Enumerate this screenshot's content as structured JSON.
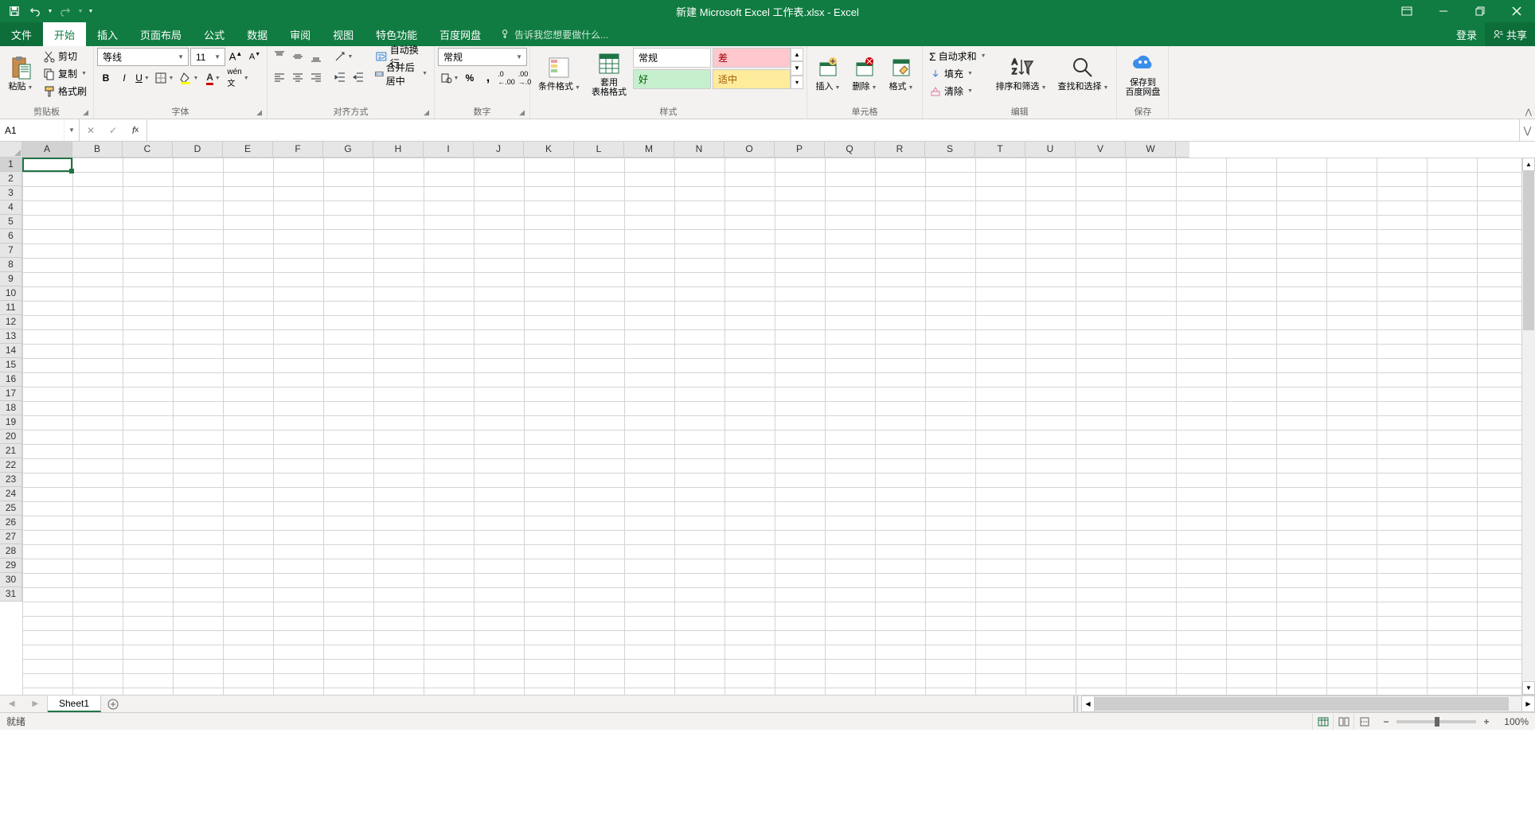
{
  "title": "新建 Microsoft Excel 工作表.xlsx - Excel",
  "qat": {
    "save": "保存",
    "undo": "撤销",
    "redo": "重做"
  },
  "tabs": {
    "file": "文件",
    "home": "开始",
    "insert": "插入",
    "pagelayout": "页面布局",
    "formulas": "公式",
    "data": "数据",
    "review": "审阅",
    "view": "视图",
    "features": "特色功能",
    "baidu": "百度网盘",
    "tellme": "告诉我您想要做什么...",
    "signin": "登录",
    "share": "共享"
  },
  "ribbon": {
    "clipboard": {
      "paste": "粘贴",
      "cut": "剪切",
      "copy": "复制",
      "format_painter": "格式刷",
      "label": "剪贴板"
    },
    "font": {
      "name": "等线",
      "size": "11",
      "label": "字体"
    },
    "alignment": {
      "wrap": "自动换行",
      "merge": "合并后居中",
      "label": "对齐方式"
    },
    "number": {
      "format": "常规",
      "label": "数字"
    },
    "styles": {
      "cond_fmt": "条件格式",
      "table_fmt": "套用\n表格格式",
      "g1": "常规",
      "g2": "差",
      "g3": "好",
      "g4": "适中",
      "label": "样式"
    },
    "cells": {
      "insert": "插入",
      "delete": "删除",
      "format": "格式",
      "label": "单元格"
    },
    "editing": {
      "autosum": "自动求和",
      "fill": "填充",
      "clear": "清除",
      "sort": "排序和筛选",
      "find": "查找和选择",
      "label": "编辑"
    },
    "baidu": {
      "save": "保存到\n百度网盘",
      "label": "保存"
    }
  },
  "formula_bar": {
    "name_box": "A1",
    "formula": ""
  },
  "columns": [
    "A",
    "B",
    "C",
    "D",
    "E",
    "F",
    "G",
    "H",
    "I",
    "J",
    "K",
    "L",
    "M",
    "N",
    "O",
    "P",
    "Q",
    "R",
    "S",
    "T",
    "U",
    "V",
    "W"
  ],
  "rows": [
    1,
    2,
    3,
    4,
    5,
    6,
    7,
    8,
    9,
    10,
    11,
    12,
    13,
    14,
    15,
    16,
    17,
    18,
    19,
    20,
    21,
    22,
    23,
    24,
    25,
    26,
    27,
    28,
    29,
    30,
    31
  ],
  "sheets": {
    "active": "Sheet1"
  },
  "status": {
    "ready": "就绪",
    "zoom": "100%"
  }
}
